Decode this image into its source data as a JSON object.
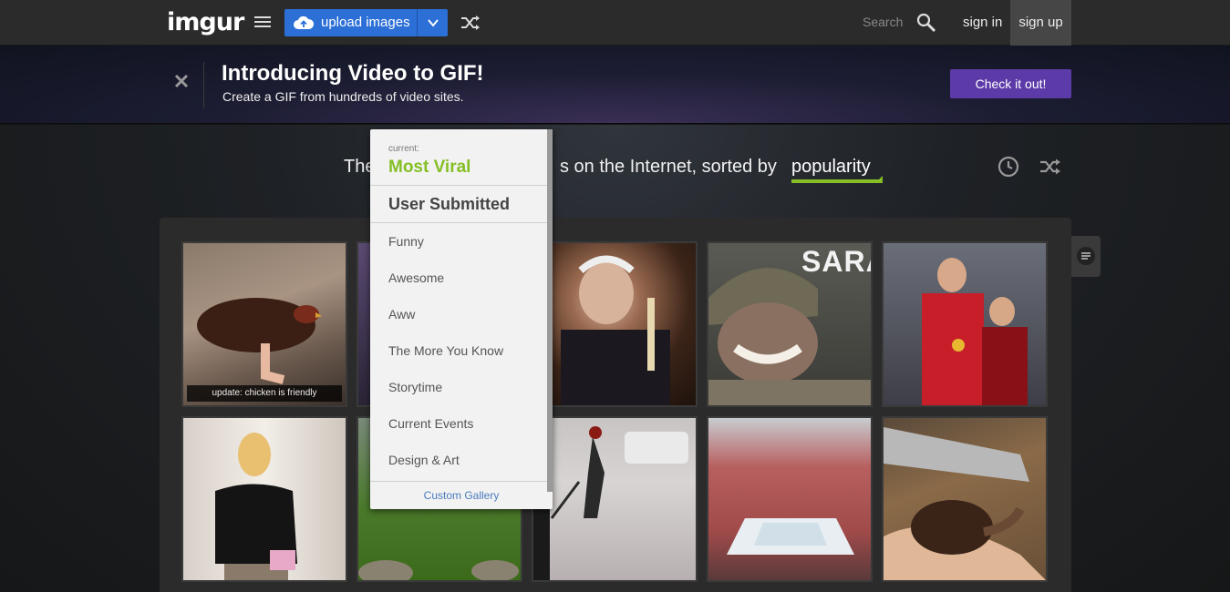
{
  "nav": {
    "logo": "imgur",
    "upload_label": "upload images",
    "search_placeholder": "Search",
    "signin": "sign in",
    "signup": "sign up"
  },
  "banner": {
    "title": "Introducing Video to GIF!",
    "subtitle": "Create a GIF from hundreds of video sites.",
    "cta": "Check it out!"
  },
  "heading": {
    "prefix": "The",
    "rest": "s on the Internet, sorted by",
    "sort": "popularity"
  },
  "dropdown": {
    "current_label": "current:",
    "current": "Most Viral",
    "user_submitted": "User Submitted",
    "items": [
      "Funny",
      "Awesome",
      "Aww",
      "The More You Know",
      "Storytime",
      "Current Events",
      "Design & Art"
    ],
    "custom": "Custom Gallery"
  },
  "gallery": {
    "captions": [
      "update: chicken is friendly"
    ],
    "overlay_text": "SARA"
  },
  "colors": {
    "accent_green": "#85bf25",
    "upload_blue": "#2c6fd6",
    "cta_purple": "#5c3aa8"
  }
}
